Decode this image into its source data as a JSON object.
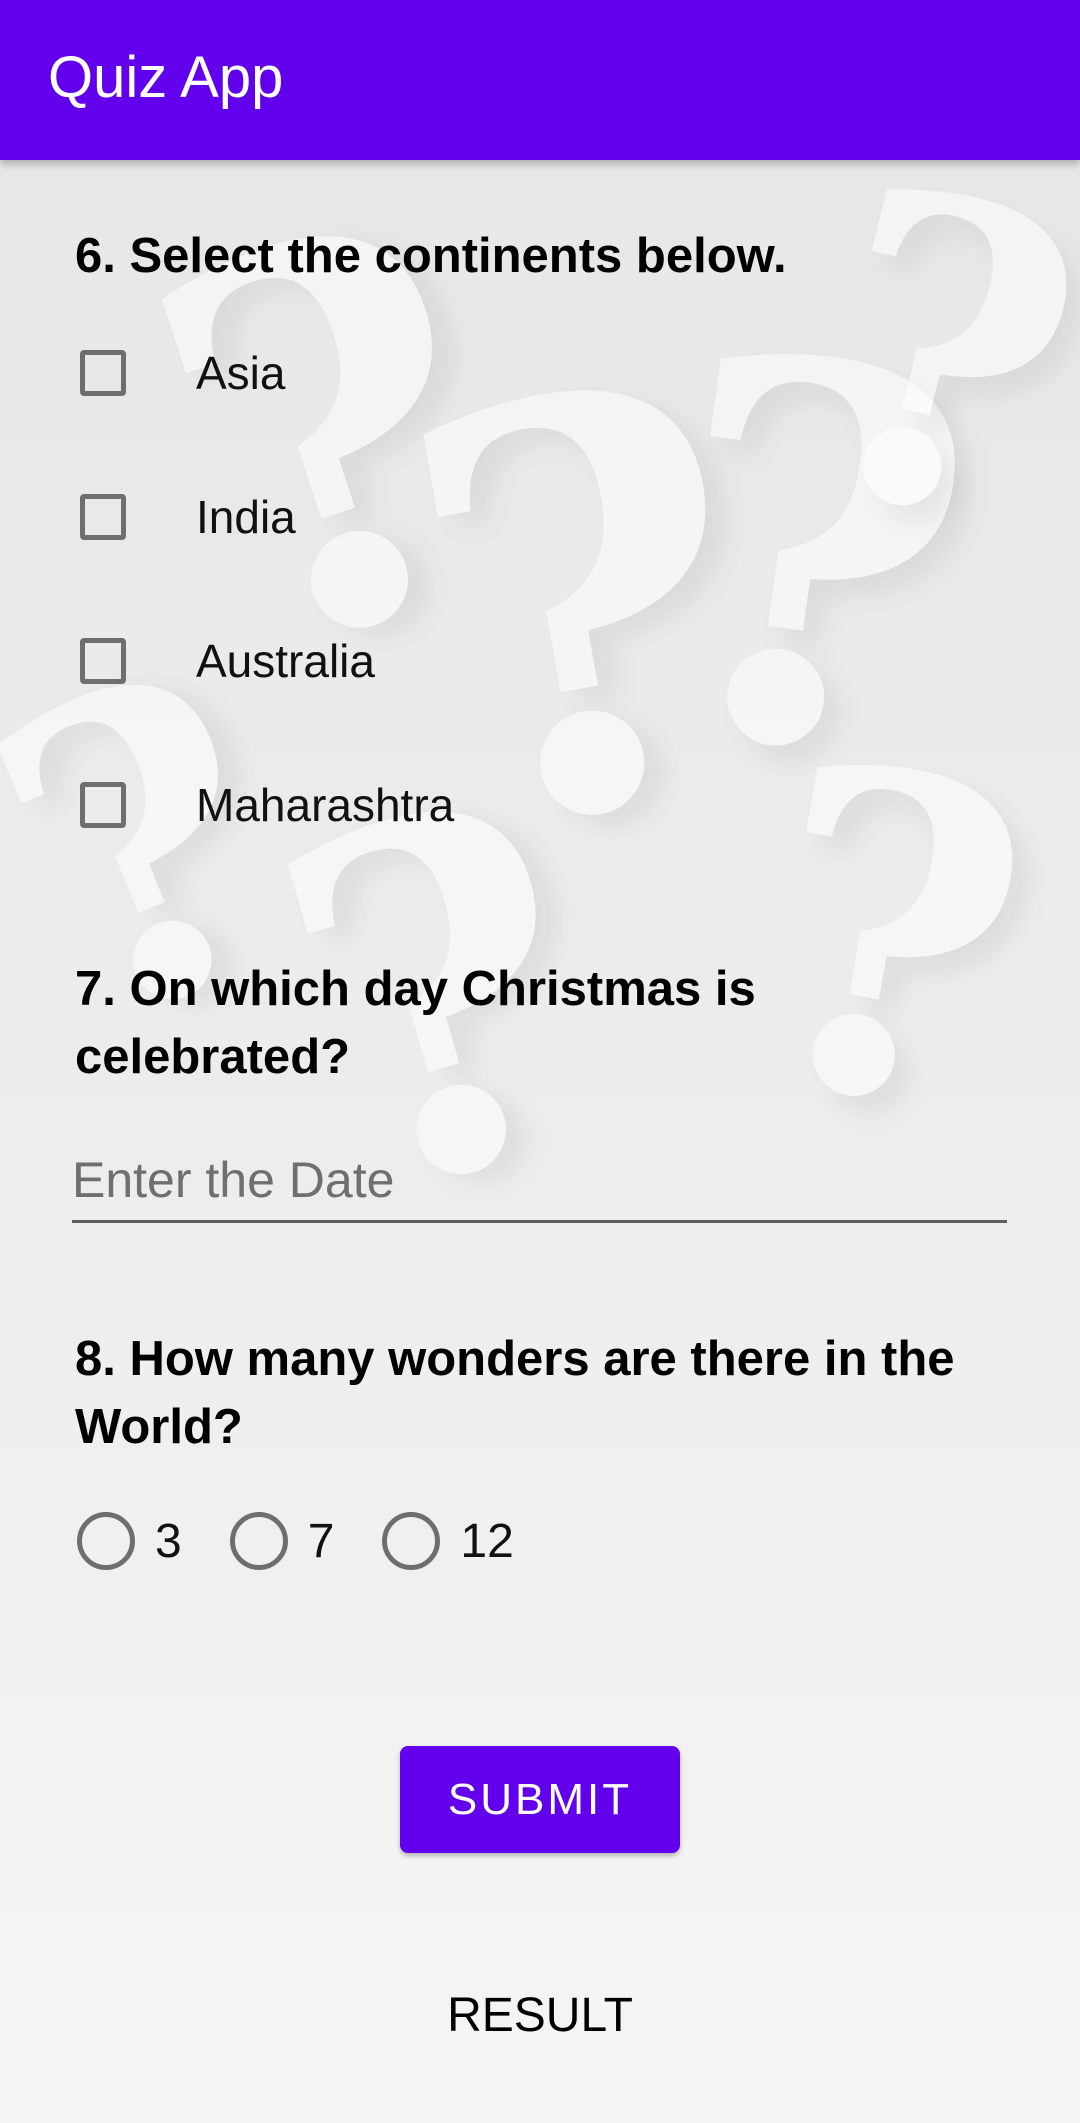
{
  "app_bar": {
    "title": "Quiz App",
    "color": "#6200ee"
  },
  "question6": {
    "text": "6. Select the continents below.",
    "options": [
      "Asia",
      "India",
      "Australia",
      "Maharashtra"
    ],
    "checked": [
      false,
      false,
      false,
      false
    ]
  },
  "question7": {
    "text": "7. On which day Christmas is celebrated?",
    "input": {
      "placeholder": "Enter the Date",
      "value": ""
    }
  },
  "question8": {
    "text": "8. How many wonders are there in the World?",
    "options": [
      "3",
      "7",
      "12"
    ],
    "selected": null
  },
  "buttons": {
    "submit_label": "SUBMIT",
    "result_label": "RESULT"
  },
  "background": {
    "icon": "question-mark-pattern"
  }
}
